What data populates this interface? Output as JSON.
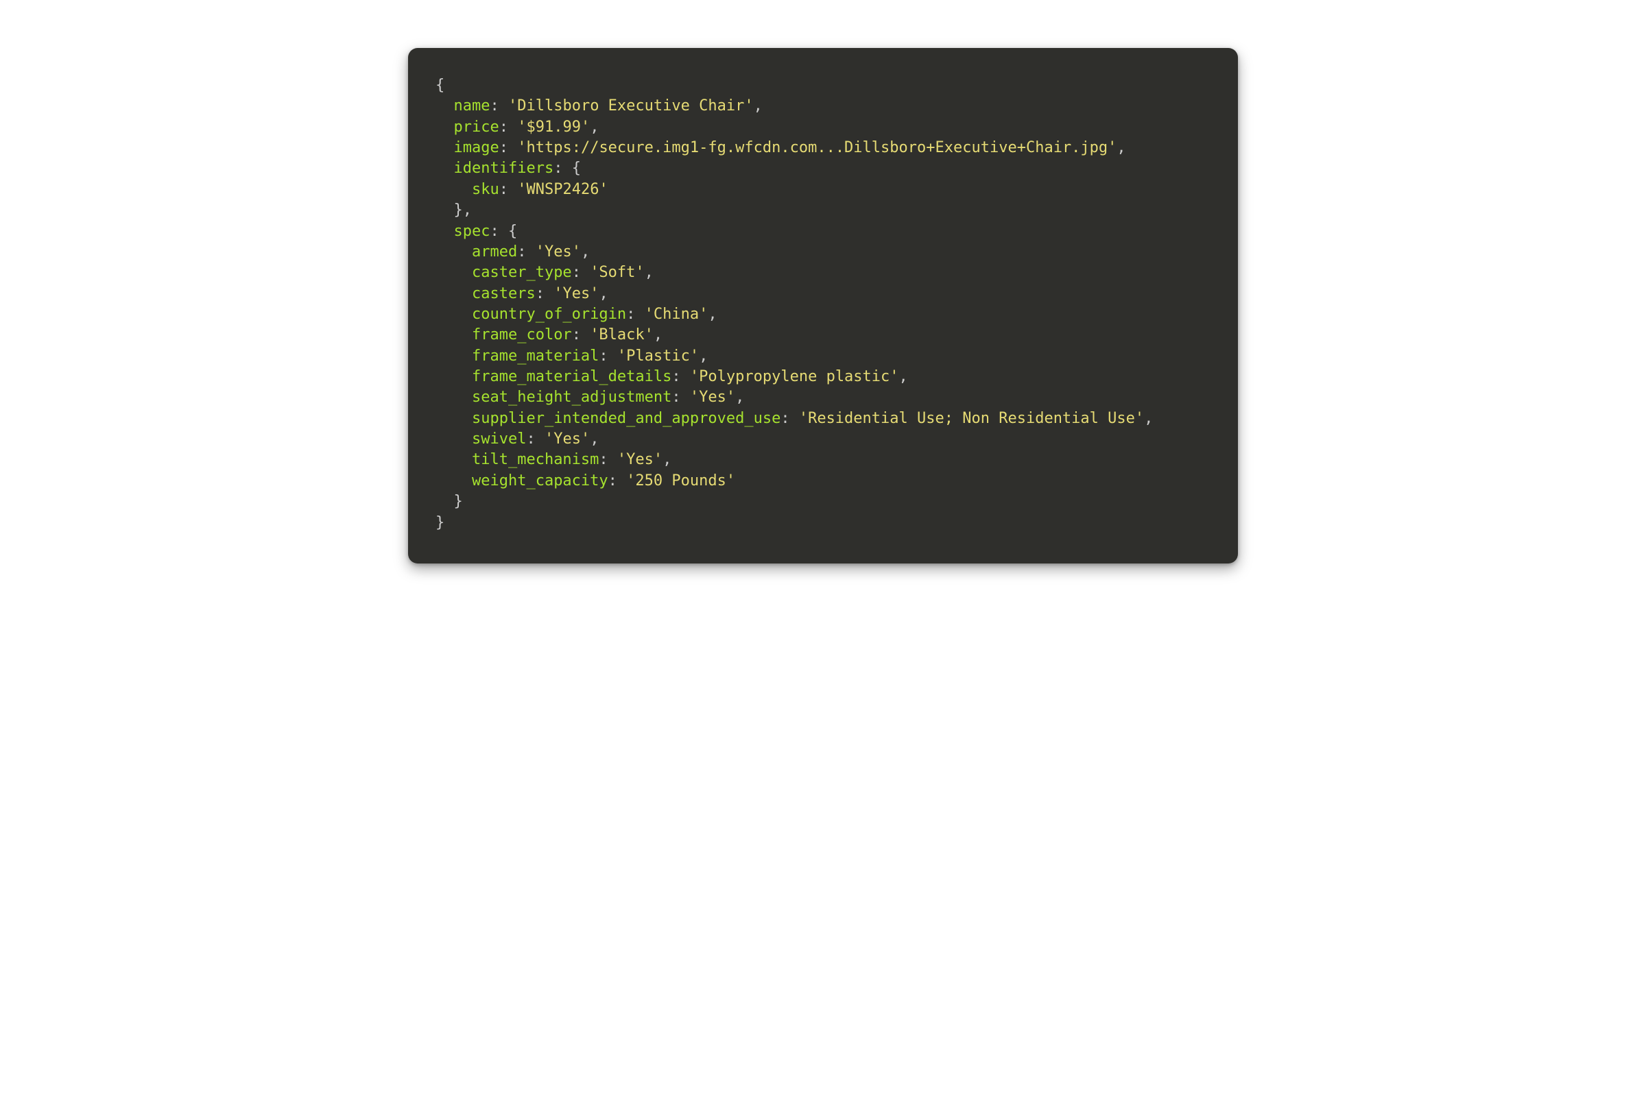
{
  "indent": "  ",
  "lines": [
    {
      "depth": 0,
      "key": null,
      "val": null,
      "before": "{",
      "after": ""
    },
    {
      "depth": 1,
      "key": "name",
      "val": "'Dillsboro Executive Chair'",
      "before": "",
      "after": ","
    },
    {
      "depth": 1,
      "key": "price",
      "val": "'$91.99'",
      "before": "",
      "after": ","
    },
    {
      "depth": 1,
      "key": "image",
      "val": "'https://secure.img1-fg.wfcdn.com...Dillsboro+Executive+Chair.jpg'",
      "before": "",
      "after": ","
    },
    {
      "depth": 1,
      "key": "identifiers",
      "val": null,
      "before": "",
      "after": ": {"
    },
    {
      "depth": 2,
      "key": "sku",
      "val": "'WNSP2426'",
      "before": "",
      "after": ""
    },
    {
      "depth": 1,
      "key": null,
      "val": null,
      "before": "},",
      "after": ""
    },
    {
      "depth": 1,
      "key": "spec",
      "val": null,
      "before": "",
      "after": ": {"
    },
    {
      "depth": 2,
      "key": "armed",
      "val": "'Yes'",
      "before": "",
      "after": ","
    },
    {
      "depth": 2,
      "key": "caster_type",
      "val": "'Soft'",
      "before": "",
      "after": ","
    },
    {
      "depth": 2,
      "key": "casters",
      "val": "'Yes'",
      "before": "",
      "after": ","
    },
    {
      "depth": 2,
      "key": "country_of_origin",
      "val": "'China'",
      "before": "",
      "after": ","
    },
    {
      "depth": 2,
      "key": "frame_color",
      "val": "'Black'",
      "before": "",
      "after": ","
    },
    {
      "depth": 2,
      "key": "frame_material",
      "val": "'Plastic'",
      "before": "",
      "after": ","
    },
    {
      "depth": 2,
      "key": "frame_material_details",
      "val": "'Polypropylene plastic'",
      "before": "",
      "after": ","
    },
    {
      "depth": 2,
      "key": "seat_height_adjustment",
      "val": "'Yes'",
      "before": "",
      "after": ","
    },
    {
      "depth": 2,
      "key": "supplier_intended_and_approved_use",
      "val": "'Residential Use; Non Residential Use'",
      "before": "",
      "after": ","
    },
    {
      "depth": 2,
      "key": "swivel",
      "val": "'Yes'",
      "before": "",
      "after": ","
    },
    {
      "depth": 2,
      "key": "tilt_mechanism",
      "val": "'Yes'",
      "before": "",
      "after": ","
    },
    {
      "depth": 2,
      "key": "weight_capacity",
      "val": "'250 Pounds'",
      "before": "",
      "after": ""
    },
    {
      "depth": 1,
      "key": null,
      "val": null,
      "before": "}",
      "after": ""
    },
    {
      "depth": 0,
      "key": null,
      "val": null,
      "before": "}",
      "after": ""
    }
  ]
}
